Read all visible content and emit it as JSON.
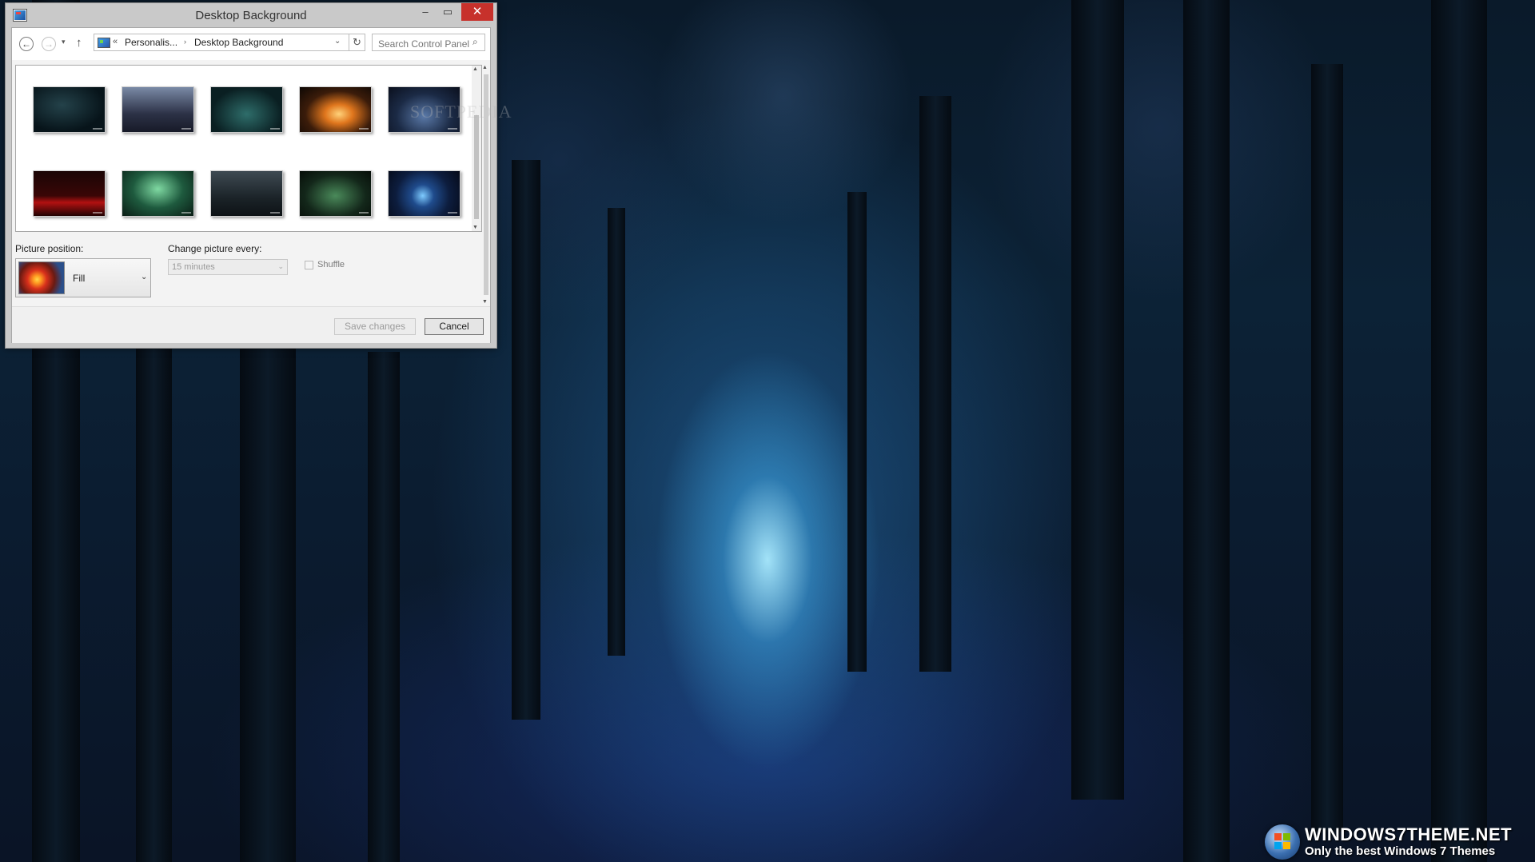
{
  "window": {
    "title": "Desktop Background",
    "minimize_label": "–",
    "maximize_label": "▭",
    "close_label": "✕"
  },
  "navigation": {
    "back_icon": "←",
    "forward_icon": "→",
    "recent_icon": "▾",
    "up_icon": "↑",
    "breadcrumb_overflow": "«",
    "breadcrumbs": [
      "Personalis...",
      "Desktop Background"
    ],
    "crumb_separator": "›",
    "address_dropdown": "⌄",
    "refresh_icon": "↻",
    "search_placeholder": "Search Control Panel",
    "search_icon": "⌕"
  },
  "gallery": {
    "thumbnail_count": 10,
    "watermark": "SOFTPEDIA"
  },
  "settings": {
    "picture_position_label": "Picture position:",
    "picture_position_value": "Fill",
    "change_picture_label": "Change picture every:",
    "change_picture_value": "15 minutes",
    "shuffle_label": "Shuffle",
    "shuffle_checked": false
  },
  "buttons": {
    "save": "Save changes",
    "cancel": "Cancel"
  },
  "branding": {
    "title": "WINDOWS7THEME.NET",
    "subtitle": "Only the best Windows 7 Themes"
  },
  "colors": {
    "close_button": "#c7312b",
    "window_chrome": "#c9c9c9"
  }
}
